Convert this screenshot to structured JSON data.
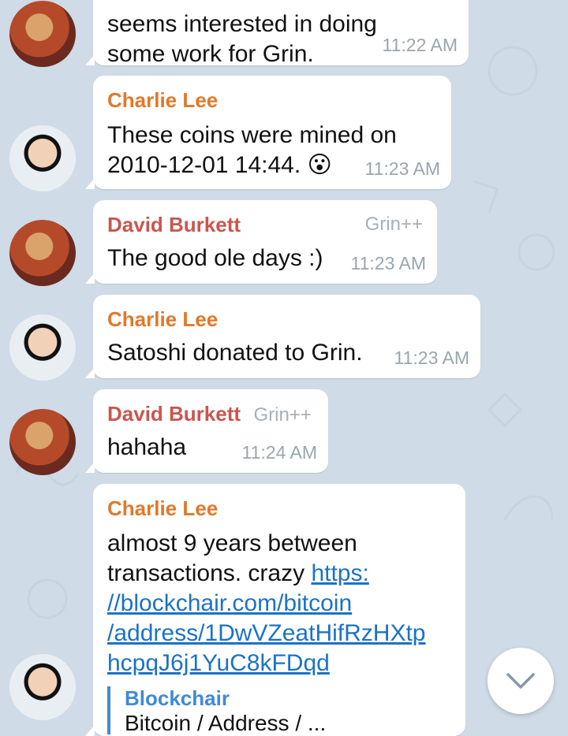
{
  "messages": [
    {
      "sender": "",
      "text": "seems interested in doing some work for Grin.",
      "time": "11:22 AM"
    },
    {
      "sender": "Charlie Lee",
      "text": "These coins were mined on 2010-12-01 14:44. 😮",
      "time": "11:23 AM"
    },
    {
      "sender": "David Burkett",
      "tag": "Grin++",
      "text": "The good ole days :)",
      "time": "11:23 AM"
    },
    {
      "sender": "Charlie Lee",
      "text": "Satoshi donated to Grin.",
      "time": "11:23 AM"
    },
    {
      "sender": "David Burkett",
      "tag": "Grin++",
      "text": "hahaha",
      "time": "11:24 AM"
    },
    {
      "sender": "Charlie Lee",
      "text_lines": [
        "almost 9 years between",
        "transactions. crazy "
      ],
      "link_lines": [
        "https:",
        "//blockchair.com/bitcoin",
        "/address/1DwVZeatHifRzHXtp",
        "hcpqJ6j1YuC8kFDqd"
      ],
      "preview_title": "Blockchair",
      "preview_subtitle": "Bitcoin / Address / ..."
    }
  ],
  "ui": {
    "scroll_down_icon": "chevron-down-icon",
    "colors": {
      "background": "#cfdbe6",
      "charlie_name": "#e0792b",
      "david_name": "#c8564f",
      "link": "#1c72c6"
    }
  }
}
